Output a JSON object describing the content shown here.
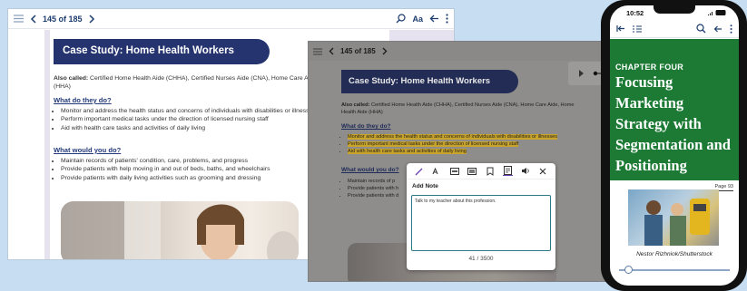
{
  "desktop": {
    "page_indicator": "145 of 185",
    "font_button": "Aa",
    "banner_title": "Case Study: Home Health Workers",
    "also_called_label": "Also called:",
    "also_called_text": " Certified Home Health Aide (CHHA), Certified Nurses Aide (CNA), Home Care Aide, Home Health Aide (HHA)",
    "section1_heading": "What do they do?",
    "section1_bullets": [
      "Monitor and address the health status and concerns of individuals with disabilities or illnesses",
      "Perform important medical tasks under the direction of licensed nursing staff",
      "Aid with health care tasks and activities of daily living"
    ],
    "section2_heading": "What would you do?",
    "section2_bullets": [
      "Maintain records of patients' condition, care, problems, and progress",
      "Provide patients with help moving in and out of beds, baths, and wheelchairs",
      "Provide patients with daily living activities such as grooming and dressing"
    ]
  },
  "tablet": {
    "page_indicator": "145 of 185",
    "banner_title": "Case Study: Home Health Workers",
    "also_called_label": "Also called:",
    "also_called_text": " Certified Home Health Aide (CHHA), Certified Nurses Aide (CNA), Home Care Aide, Home Health Aide (HHA)",
    "section1_heading": "What do they do?",
    "section1_bullets": [
      "Monitor and address the health status and concerns of individuals with disabilities or illnesses",
      "Perform important medical tasks under the direction of licensed nursing staff",
      "Aid with health care tasks and activities of daily living"
    ],
    "section2_heading": "What would you do?",
    "section2_bullets": [
      "Maintain records of p",
      "Provide patients with h",
      "Provide patients with d"
    ],
    "note": {
      "label": "Add Note",
      "text": "Talk to my teacher about this profession.",
      "counter": "41 / 3500"
    }
  },
  "phone": {
    "time": "10:52",
    "chapter": "CHAPTER FOUR",
    "title": "Focusing Marketing Strategy with Segmentation and Positioning",
    "page_label": "Page 93",
    "photo_credit": "Nestor Rizhniok/Shutterstock"
  },
  "colors": {
    "banner": "#25346f",
    "heading": "#223a7a",
    "highlight": "#c9a42a",
    "chapter_green": "#1c7a35"
  }
}
